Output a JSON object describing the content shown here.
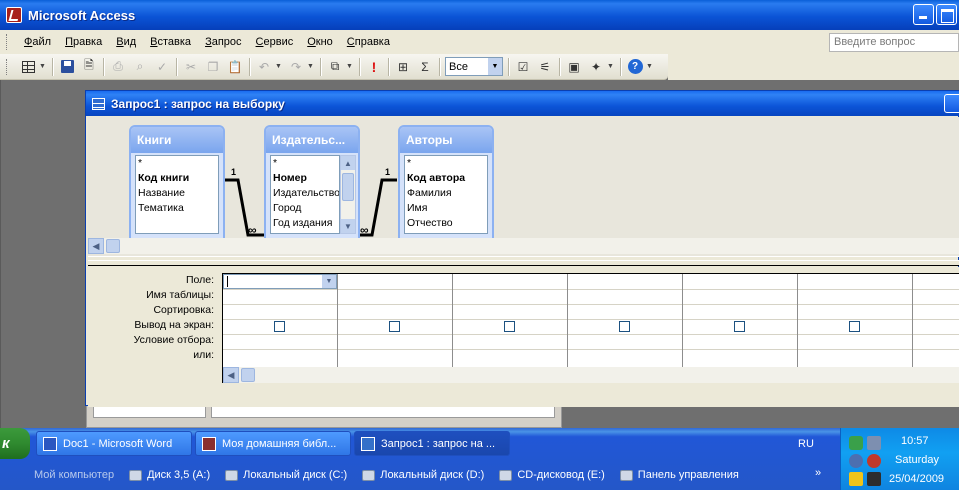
{
  "app": {
    "title": "Microsoft Access"
  },
  "menu": {
    "items": [
      "Файл",
      "Правка",
      "Вид",
      "Вставка",
      "Запрос",
      "Сервис",
      "Окно",
      "Справка"
    ],
    "question_placeholder": "Введите вопрос"
  },
  "toolbar": {
    "top_values": "Все",
    "sigma": "Σ"
  },
  "query_window": {
    "title": "Запрос1 : запрос на выборку",
    "tables": [
      {
        "name": "Книги",
        "fields": [
          "*",
          "Код книги",
          "Название",
          "Тематика"
        ],
        "key_index": 1
      },
      {
        "name": "Издательс...",
        "fields": [
          "*",
          "Номер",
          "Издательство",
          "Город",
          "Год издания"
        ],
        "key_index": 1
      },
      {
        "name": "Авторы",
        "fields": [
          "*",
          "Код автора",
          "Фамилия",
          "Имя",
          "Отчество"
        ],
        "key_index": 1
      }
    ],
    "relations": [
      {
        "from_label": "1",
        "to_label": "∞"
      },
      {
        "from_label": "1",
        "to_label": "∞"
      }
    ],
    "grid_row_labels": [
      "Поле:",
      "Имя таблицы:",
      "Сортировка:",
      "Вывод на экран:",
      "Условие отбора:",
      "или:"
    ],
    "grid_columns": 7
  },
  "taskbar": {
    "start_label": "к",
    "tasks": [
      {
        "label": "Doc1 - Microsoft Word",
        "icon": "word-icon",
        "active": false
      },
      {
        "label": "Моя домашняя библ...",
        "icon": "access-icon",
        "active": false
      },
      {
        "label": "Запрос1 : запрос на ...",
        "icon": "query-icon",
        "active": true
      }
    ],
    "language": "RU",
    "quick_launch": [
      "Мой компьютер",
      "Диск 3,5 (A:)",
      "Локальный диск (C:)",
      "Локальный диск (D:)",
      "CD-дисковод (E:)",
      "Панель управления"
    ],
    "chevron": "»",
    "clock": {
      "time": "10:57",
      "day": "Saturday",
      "date": "25/04/2009"
    }
  },
  "colors": {
    "xp_blue": "#0b54d6",
    "face": "#ece9d8",
    "tray": "#11a0f2"
  }
}
